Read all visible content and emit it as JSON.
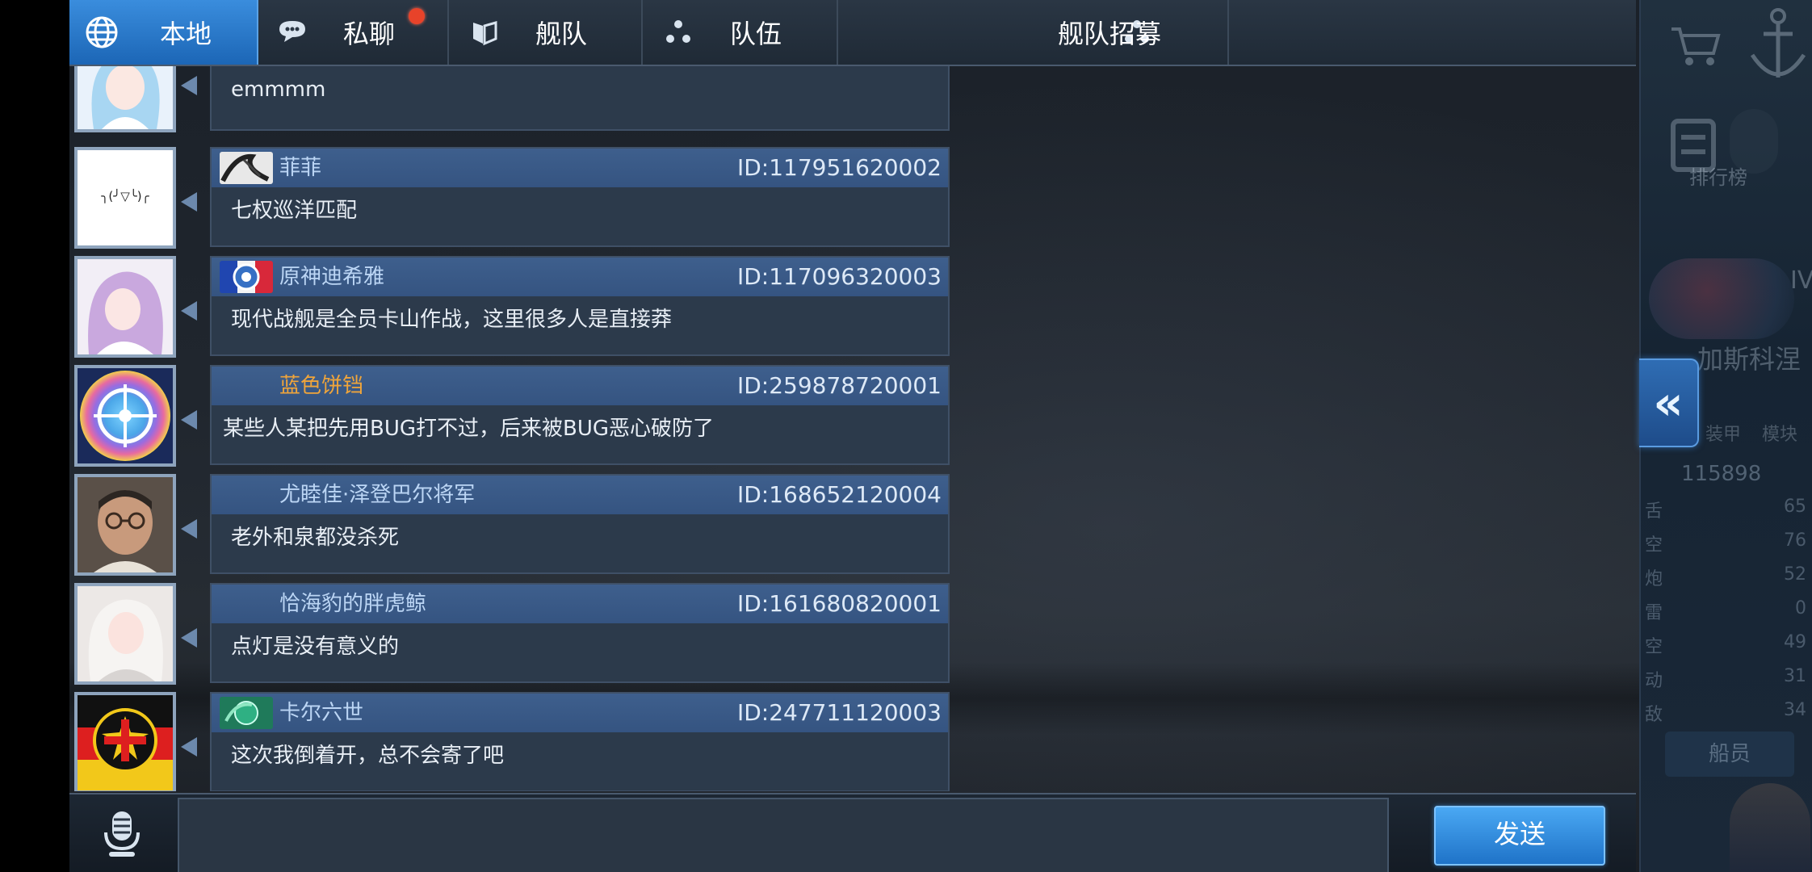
{
  "tabs": [
    {
      "label": "本地",
      "icon": "globe-icon",
      "active": true
    },
    {
      "label": "私聊",
      "icon": "chat-bubble-icon",
      "active": false,
      "has_notification": true
    },
    {
      "label": "舰队",
      "icon": "fleet-emblem-icon",
      "active": false
    },
    {
      "label": "队伍",
      "icon": "team-dots-icon",
      "active": false
    },
    {
      "label": "舰队招募",
      "icon": "team-dots-icon",
      "active": false
    }
  ],
  "messages": [
    {
      "name": "",
      "id": "",
      "text": "emmmm",
      "avatar": "anime-girl-blue-avatar"
    },
    {
      "name": "菲菲",
      "id": "ID:117951620002",
      "text": "七权巡洋匹配",
      "avatar": "kaomoji-avatar",
      "avatar_text": "╮(╯▽╰)╭",
      "badge": "ink-badge"
    },
    {
      "name": "原神迪希雅",
      "id": "ID:117096320003",
      "text": "现代战舰是全员卡山作战，这里很多人是直接莽",
      "avatar": "anime-girl-purple-avatar",
      "badge": "france-flag-badge"
    },
    {
      "name": "蓝色饼铛",
      "id": "ID:259878720001",
      "text": "某些人某把先用BUG打不过，后来被BUG恶心破防了",
      "avatar": "rainbow-target-avatar",
      "name_color": "#f0a53a"
    },
    {
      "name": "尤睦佳·泽登巴尔将军",
      "id": "ID:168652120004",
      "text": "老外和泉都没杀死",
      "avatar": "man-glasses-avatar"
    },
    {
      "name": "恰海豹的胖虎鲸",
      "id": "ID:161680820001",
      "text": "点灯是没有意义的",
      "avatar": "anime-girl-white-avatar"
    },
    {
      "name": "卡尔六世",
      "id": "ID:247711120003",
      "text": "这次我倒着开，总不会寄了吧",
      "avatar": "iron-cross-avatar",
      "badge": "green-emblem-badge"
    }
  ],
  "input": {
    "value": "",
    "placeholder": ""
  },
  "send_label": "发送",
  "collapse_label": "«",
  "side_panel": {
    "rank_text": "排行榜",
    "roman": "IV",
    "ship_name": "加斯科涅",
    "tab_a": "装甲",
    "tab_b": "模块",
    "stat_num": "115898",
    "stats": [
      {
        "label": "舌",
        "value": "65"
      },
      {
        "label": "空",
        "value": "76"
      },
      {
        "label": "炮",
        "value": "52"
      },
      {
        "label": "雷",
        "value": "0"
      },
      {
        "label": "空",
        "value": "49"
      },
      {
        "label": "动",
        "value": "31"
      },
      {
        "label": "敌",
        "value": "34"
      }
    ],
    "crew_label": "船员"
  },
  "colors": {
    "accent": "#2c7fd2",
    "bubble": "#2c3a4b",
    "header": "#3a5b88",
    "notify": "#e8432a"
  }
}
